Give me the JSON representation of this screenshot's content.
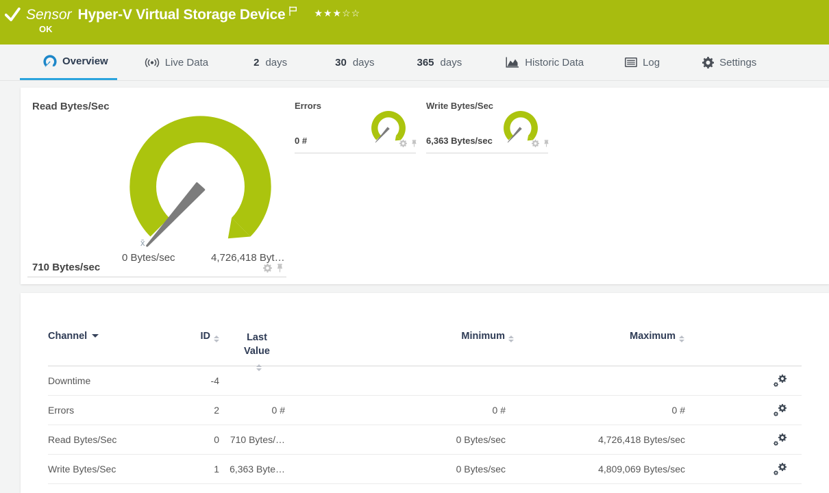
{
  "colors": {
    "banner_green": "#a8bc0f",
    "gauge_green": "#abc40e",
    "active_tab_blue": "#2ba4dd",
    "overview_icon_blue": "#1d87c9",
    "needle_gray": "#7c7c7c"
  },
  "header": {
    "kind_label": "Sensor",
    "title": "Hyper-V Virtual Storage Device",
    "status": "OK",
    "stars": "★★★☆☆",
    "stars_filled": 3,
    "stars_total": 5
  },
  "tabs": [
    {
      "label": "Overview",
      "active": true
    },
    {
      "label": "Live Data"
    },
    {
      "prefix": "2",
      "label": "days"
    },
    {
      "prefix": "30",
      "label": "days"
    },
    {
      "prefix": "365",
      "label": "days"
    },
    {
      "label": "Historic Data"
    },
    {
      "label": "Log"
    },
    {
      "label": "Settings"
    }
  ],
  "gauges": {
    "read": {
      "title": "Read Bytes/Sec",
      "value": "710 Bytes/sec",
      "scale_min": "0 Bytes/sec",
      "scale_max": "4,726,418 Byt…",
      "mean_marker": "x̄"
    },
    "errors": {
      "title": "Errors",
      "value": "0 #"
    },
    "write": {
      "title": "Write Bytes/Sec",
      "value": "6,363 Bytes/sec"
    }
  },
  "table": {
    "headers": {
      "channel": "Channel",
      "id": "ID",
      "last_value": "Last Value",
      "minimum": "Minimum",
      "maximum": "Maximum"
    },
    "rows": [
      {
        "channel": "Downtime",
        "id": "-4",
        "last": "",
        "min": "",
        "max": ""
      },
      {
        "channel": "Errors",
        "id": "2",
        "last": "0 #",
        "min": "0 #",
        "max": "0 #"
      },
      {
        "channel": "Read Bytes/Sec",
        "id": "0",
        "last": "710 Bytes/…",
        "min": "0 Bytes/sec",
        "max": "4,726,418 Bytes/sec"
      },
      {
        "channel": "Write Bytes/Sec",
        "id": "1",
        "last": "6,363 Byte…",
        "min": "0 Bytes/sec",
        "max": "4,809,069 Bytes/sec"
      }
    ]
  }
}
